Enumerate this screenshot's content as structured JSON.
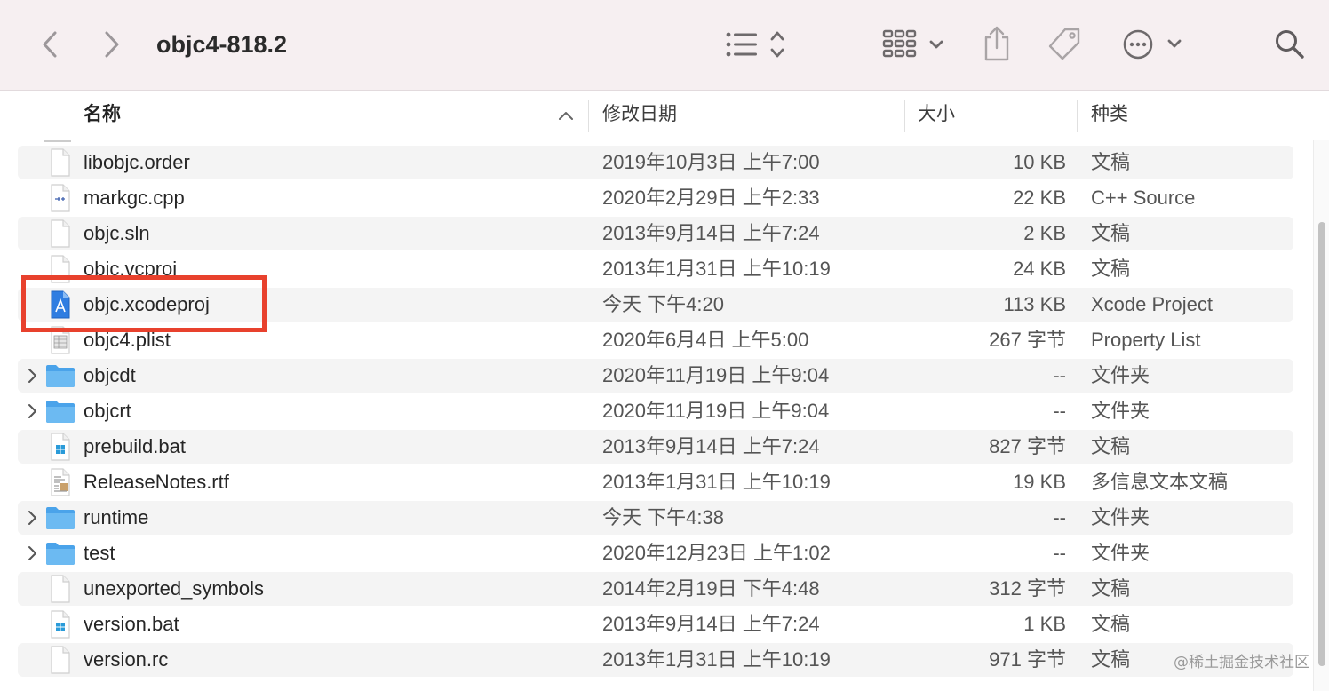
{
  "window": {
    "title": "objc4-818.2"
  },
  "toolbar": {
    "back_icon": "chevron-left-icon",
    "forward_icon": "chevron-right-icon",
    "list_view_icon": "list-view-icon",
    "grid_view_icon": "grid-view-icon",
    "share_icon": "share-icon",
    "tag_icon": "tag-icon",
    "more_icon": "ellipsis-circle-icon",
    "search_icon": "search-icon"
  },
  "columns": {
    "name": "名称",
    "date": "修改日期",
    "size": "大小",
    "kind": "种类"
  },
  "files": [
    {
      "name": "libobjc.order",
      "date": "2019年10月3日 上午7:00",
      "size": "10 KB",
      "kind": "文稿",
      "icon": "document-icon",
      "folder": false
    },
    {
      "name": "markgc.cpp",
      "date": "2020年2月29日 上午2:33",
      "size": "22 KB",
      "kind": "C++ Source",
      "icon": "cpp-file-icon",
      "folder": false
    },
    {
      "name": "objc.sln",
      "date": "2013年9月14日 上午7:24",
      "size": "2 KB",
      "kind": "文稿",
      "icon": "document-icon",
      "folder": false
    },
    {
      "name": "objc.vcproj",
      "date": "2013年1月31日 上午10:19",
      "size": "24 KB",
      "kind": "文稿",
      "icon": "document-icon",
      "folder": false
    },
    {
      "name": "objc.xcodeproj",
      "date": "今天 下午4:20",
      "size": "113 KB",
      "kind": "Xcode Project",
      "icon": "xcode-project-icon",
      "folder": false
    },
    {
      "name": "objc4.plist",
      "date": "2020年6月4日 上午5:00",
      "size": "267 字节",
      "kind": "Property List",
      "icon": "plist-file-icon",
      "folder": false
    },
    {
      "name": "objcdt",
      "date": "2020年11月19日 上午9:04",
      "size": "--",
      "kind": "文件夹",
      "icon": "folder-icon",
      "folder": true
    },
    {
      "name": "objcrt",
      "date": "2020年11月19日 上午9:04",
      "size": "--",
      "kind": "文件夹",
      "icon": "folder-icon",
      "folder": true
    },
    {
      "name": "prebuild.bat",
      "date": "2013年9月14日 上午7:24",
      "size": "827 字节",
      "kind": "文稿",
      "icon": "bat-file-icon",
      "folder": false
    },
    {
      "name": "ReleaseNotes.rtf",
      "date": "2013年1月31日 上午10:19",
      "size": "19 KB",
      "kind": "多信息文本文稿",
      "icon": "rtf-file-icon",
      "folder": false
    },
    {
      "name": "runtime",
      "date": "今天 下午4:38",
      "size": "--",
      "kind": "文件夹",
      "icon": "folder-icon",
      "folder": true
    },
    {
      "name": "test",
      "date": "2020年12月23日 上午1:02",
      "size": "--",
      "kind": "文件夹",
      "icon": "folder-icon",
      "folder": true
    },
    {
      "name": "unexported_symbols",
      "date": "2014年2月19日 下午4:48",
      "size": "312 字节",
      "kind": "文稿",
      "icon": "document-icon",
      "folder": false
    },
    {
      "name": "version.bat",
      "date": "2013年9月14日 上午7:24",
      "size": "1 KB",
      "kind": "文稿",
      "icon": "bat-file-icon",
      "folder": false
    },
    {
      "name": "version.rc",
      "date": "2013年1月31日 上午10:19",
      "size": "971 字节",
      "kind": "文稿",
      "icon": "document-icon",
      "folder": false
    }
  ],
  "watermark": "@稀土掘金技术社区",
  "colors": {
    "highlight": "#e8412d",
    "folder": "#5db2ef",
    "toolbar_bg": "#f6eff1"
  }
}
